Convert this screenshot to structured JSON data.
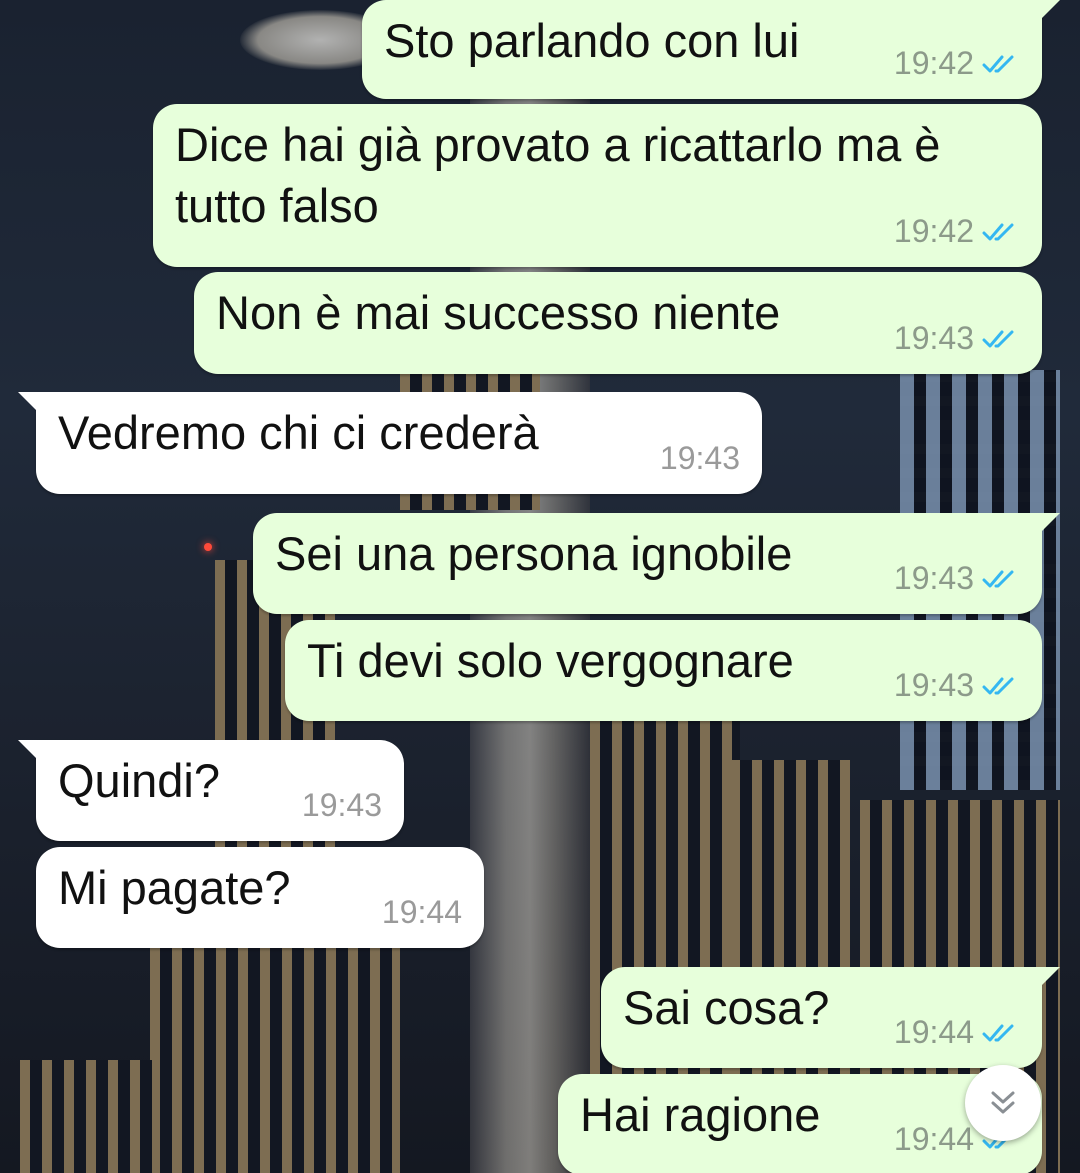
{
  "messages": [
    {
      "text": "Sto parlando con lui",
      "time": "19:42",
      "direction": "out",
      "status": "read"
    },
    {
      "text": "Dice hai già provato a ricattarlo ma è tutto falso",
      "time": "19:42",
      "direction": "out",
      "status": "read"
    },
    {
      "text": "Non è mai successo niente",
      "time": "19:43",
      "direction": "out",
      "status": "read"
    },
    {
      "text": "Vedremo chi ci crederà",
      "time": "19:43",
      "direction": "in"
    },
    {
      "text": "Sei una persona ignobile",
      "time": "19:43",
      "direction": "out",
      "status": "read"
    },
    {
      "text": "Ti devi solo vergognare",
      "time": "19:43",
      "direction": "out",
      "status": "read"
    },
    {
      "text": "Quindi?",
      "time": "19:43",
      "direction": "in"
    },
    {
      "text": "Mi pagate?",
      "time": "19:44",
      "direction": "in"
    },
    {
      "text": "Sai cosa?",
      "time": "19:44",
      "direction": "out",
      "status": "read"
    },
    {
      "text": "Hai ragione",
      "time": "19:44",
      "direction": "out",
      "status": "read"
    }
  ],
  "colors": {
    "outgoing_bubble": "#e7ffdb",
    "incoming_bubble": "#ffffff",
    "read_ticks": "#34b7f1",
    "timestamp": "#8c9a8a"
  },
  "icons": {
    "read_receipt": "double-check-icon",
    "scroll_down": "double-chevron-down-icon"
  }
}
